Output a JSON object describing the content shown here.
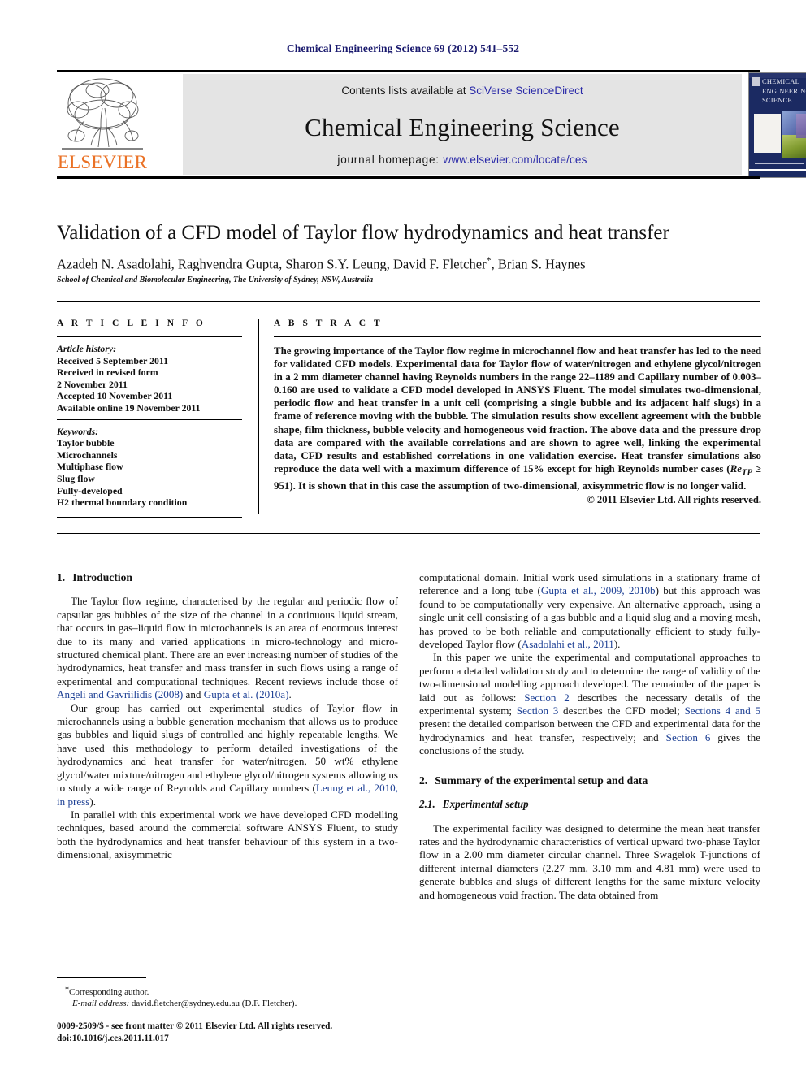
{
  "running_head": "Chemical Engineering Science 69 (2012) 541–552",
  "masthead": {
    "contents_prefix": "Contents lists available at ",
    "contents_link": "SciVerse ScienceDirect",
    "journal_title": "Chemical Engineering Science",
    "homepage_prefix": "journal homepage: ",
    "homepage_link": "www.elsevier.com/locate/ces",
    "publisher_wordmark": "ELSEVIER",
    "publisher_color": "#ea7125",
    "cover_title_line1": "CHEMICAL",
    "cover_title_line2": "ENGINEERING",
    "cover_title_line3": "SCIENCE",
    "cover_background": "#1b2a62"
  },
  "article": {
    "title": "Validation of a CFD model of Taylor flow hydrodynamics and heat transfer",
    "authors": "Azadeh N. Asadolahi, Raghvendra Gupta, Sharon S.Y. Leung, David F. Fletcher",
    "authors_tail": ", Brian S. Haynes",
    "corresponding_marker": "*",
    "affiliation": "School of Chemical and Biomolecular Engineering, The University of Sydney, NSW, Australia"
  },
  "info": {
    "heading": "A R T I C L E   I N F O",
    "history_label": "Article history:",
    "history": [
      "Received 5 September 2011",
      "Received in revised form",
      "2 November 2011",
      "Accepted 10 November 2011",
      "Available online 19 November 2011"
    ],
    "keywords_label": "Keywords:",
    "keywords": [
      "Taylor bubble",
      "Microchannels",
      "Multiphase flow",
      "Slug flow",
      "Fully-developed",
      "H2 thermal boundary condition"
    ]
  },
  "abstract": {
    "heading": "A B S T R A C T",
    "text": "The growing importance of the Taylor flow regime in microchannel flow and heat transfer has led to the need for validated CFD models. Experimental data for Taylor flow of water/nitrogen and ethylene glycol/nitrogen in a 2 mm diameter channel having Reynolds numbers in the range 22–1189 and Capillary number of 0.003–0.160 are used to validate a CFD model developed in ANSYS Fluent. The model simulates two-dimensional, periodic flow and heat transfer in a unit cell (comprising a single bubble and its adjacent half slugs) in a frame of reference moving with the bubble. The simulation results show excellent agreement with the bubble shape, film thickness, bubble velocity and homogeneous void fraction. The above data and the pressure drop data are compared with the available correlations and are shown to agree well, linking the experimental data, CFD results and established correlations in one validation exercise. Heat transfer simulations also reproduce the data well with a maximum difference of 15% except for high Reynolds number cases (ReTP ≥ 951). It is shown that in this case the assumption of two-dimensional, axisymmetric flow is no longer valid.",
    "text_part1": "The growing importance of the Taylor flow regime in microchannel flow and heat transfer has led to the need for validated CFD models. Experimental data for Taylor flow of water/nitrogen and ethylene glycol/nitrogen in a 2 mm diameter channel having Reynolds numbers in the range 22–1189 and Capillary number of 0.003–0.160 are used to validate a CFD model developed in ANSYS Fluent. The model simulates two-dimensional, periodic flow and heat transfer in a unit cell (comprising a single bubble and its adjacent half slugs) in a frame of reference moving with the bubble. The simulation results show excellent agreement with the bubble shape, film thickness, bubble velocity and homogeneous void fraction. The above data and the pressure drop data are compared with the available correlations and are shown to agree well, linking the experimental data, CFD results and established correlations in one validation exercise. Heat transfer simulations also reproduce the data well with a maximum difference of 15% except for high Reynolds number cases (",
    "re_symbol": "Re",
    "re_sub": "TP",
    "text_part2": " ≥ 951). It is shown that in this case the assumption of two-dimensional, axisymmetric flow is no longer valid.",
    "copyright": "© 2011 Elsevier Ltd. All rights reserved."
  },
  "sections": {
    "intro": {
      "number": "1.",
      "title": "Introduction",
      "p1_a": "The Taylor flow regime, characterised by the regular and periodic flow of capsular gas bubbles of the size of the channel in a continuous liquid stream, that occurs in gas–liquid flow in microchannels is an area of enormous interest due to its many and varied applications in micro-technology and micro-structured chemical plant. There are an ever increasing number of studies of the hydrodynamics, heat transfer and mass transfer in such flows using a range of experimental and computational techniques. Recent reviews include those of ",
      "p1_ref1": "Angeli and Gavriilidis (2008)",
      "p1_b": " and ",
      "p1_ref2": "Gupta et al. (2010a)",
      "p1_c": ".",
      "p2": "Our group has carried out experimental studies of Taylor flow in microchannels using a bubble generation mechanism that allows us to produce gas bubbles and liquid slugs of controlled and highly repeatable lengths. We have used this methodology to perform detailed investigations of the hydrodynamics and heat transfer for water/nitrogen, 50 wt% ethylene glycol/water mixture/nitrogen and ethylene glycol/nitrogen systems allowing us to study a wide range of Reynolds and Capillary numbers (",
      "p2_ref": "Leung et al., 2010, in press",
      "p2_b": ").",
      "p3": "In parallel with this experimental work we have developed CFD modelling techniques, based around the commercial software ANSYS Fluent, to study both the hydrodynamics and heat transfer behaviour of this system in a two-dimensional, axisymmetric",
      "p4_a": "computational domain. Initial work used simulations in a stationary frame of reference and a long tube (",
      "p4_ref1": "Gupta et al., 2009, 2010b",
      "p4_b": ") but this approach was found to be computationally very expensive. An alternative approach, using a single unit cell consisting of a gas bubble and a liquid slug and a moving mesh, has proved to be both reliable and computationally efficient to study fully-developed Taylor flow (",
      "p4_ref2": "Asadolahi et al., 2011",
      "p4_c": ").",
      "p5_a": "In this paper we unite the experimental and computational approaches to perform a detailed validation study and to determine the range of validity of the two-dimensional modelling approach developed. The remainder of the paper is laid out as follows: ",
      "p5_ref1": "Section 2",
      "p5_b": " describes the necessary details of the experimental system; ",
      "p5_ref2": "Section 3",
      "p5_c": " describes the CFD model; ",
      "p5_ref3": "Sections 4 and 5",
      "p5_d": " present the detailed comparison between the CFD and experimental data for the hydrodynamics and heat transfer, respectively; and ",
      "p5_ref4": "Section 6",
      "p5_e": " gives the conclusions of the study."
    },
    "summary": {
      "number": "2.",
      "title": "Summary of the experimental setup and data",
      "sub_number": "2.1.",
      "sub_title": "Experimental setup",
      "p1": "The experimental facility was designed to determine the mean heat transfer rates and the hydrodynamic characteristics of vertical upward two-phase Taylor flow in a 2.00 mm diameter circular channel. Three Swagelok T-junctions of different internal diameters (2.27 mm, 3.10 mm and 4.81 mm) were used to generate bubbles and slugs of different lengths for the same mixture velocity and homogeneous void fraction. The data obtained from"
    }
  },
  "footnote": {
    "corresponding": "Corresponding author.",
    "email_label": "E-mail address:",
    "email": " david.fletcher@sydney.edu.au (D.F. Fletcher).",
    "imprint_line1": "0009-2509/$ - see front matter © 2011 Elsevier Ltd. All rights reserved.",
    "imprint_line2": "doi:10.1016/j.ces.2011.11.017"
  }
}
